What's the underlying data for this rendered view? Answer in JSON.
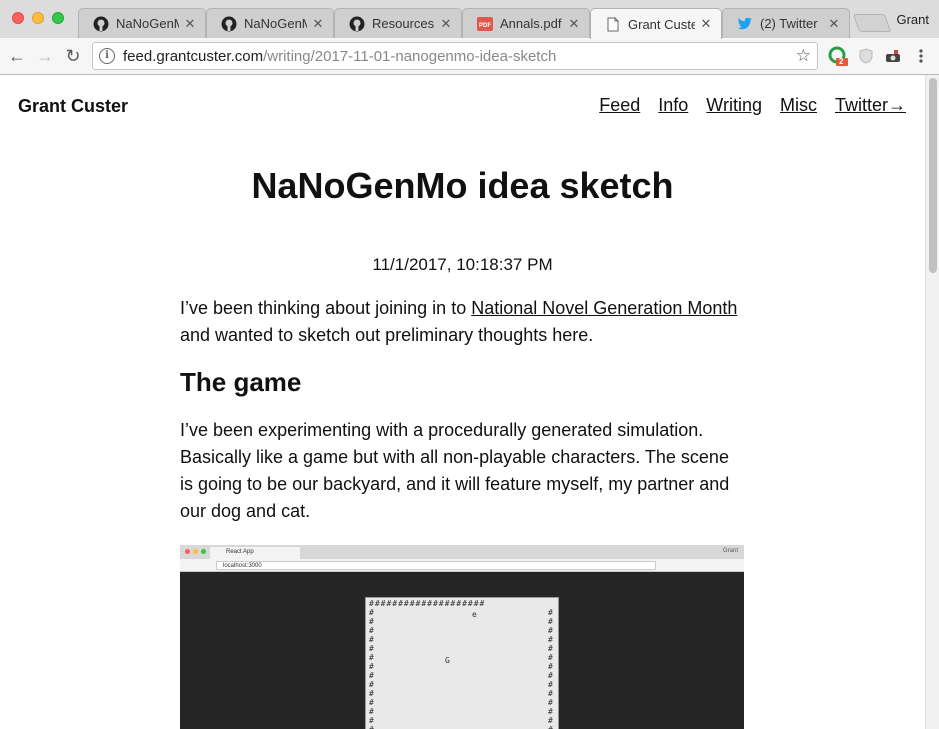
{
  "browser": {
    "tabs": [
      {
        "label": "NaNoGenMo",
        "icon": "github-icon"
      },
      {
        "label": "NaNoGenMo",
        "icon": "github-icon"
      },
      {
        "label": "Resources · I",
        "icon": "github-icon"
      },
      {
        "label": "Annals.pdf – ",
        "icon": "pdf-icon"
      },
      {
        "label": "Grant Custer",
        "icon": "document-icon",
        "active": true
      },
      {
        "label": "(2) Twitter",
        "icon": "twitter-icon"
      }
    ],
    "profile_name": "Grant",
    "url_host": "feed.grantcuster.com",
    "url_path": "/writing/2017-11-01-nanogenmo-idea-sketch",
    "extension_badge": "2"
  },
  "site": {
    "title": "Grant Custer",
    "nav": [
      "Feed",
      "Info",
      "Writing",
      "Misc",
      "Twitter→"
    ]
  },
  "post": {
    "title": "NaNoGenMo idea sketch",
    "date": "11/1/2017, 10:18:37 PM",
    "intro_before": "I’ve been thinking about joining in to ",
    "intro_link": "National Novel Generation Month",
    "intro_after": " and wanted to sketch out preliminary thoughts here.",
    "heading": "The game",
    "paragraph": "I’ve been experimenting with a procedurally generated simulation. Basically like a game but with all non-playable characters. The scene is going to be our backyard, and it will feature myself, my partner and our dog and cat."
  },
  "screenshot": {
    "tab_label": "React App",
    "url": "localhost:3000",
    "profile": "Grant",
    "hash_row": "####################",
    "glyph_e": "e",
    "glyph_g": "G"
  },
  "colors": {
    "twitter": "#1da1f2",
    "pdf": "#e2574c",
    "github": "#222222"
  }
}
